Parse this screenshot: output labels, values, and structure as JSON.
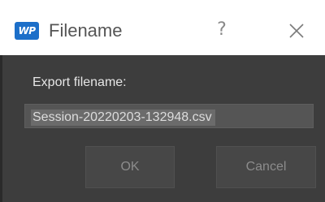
{
  "window": {
    "title": "Filename",
    "app_icon_text": "WP",
    "help_label": "?",
    "close_icon": "close-icon"
  },
  "dialog": {
    "label": "Export filename:",
    "filename_value": "Session-20220203-132948.csv",
    "ok_label": "OK",
    "cancel_label": "Cancel"
  },
  "colors": {
    "titlebar_bg": "#ffffff",
    "body_bg": "#3d3d3d",
    "app_icon_bg": "#1c6fc9",
    "input_bg": "#555555",
    "button_bg": "#474747"
  }
}
